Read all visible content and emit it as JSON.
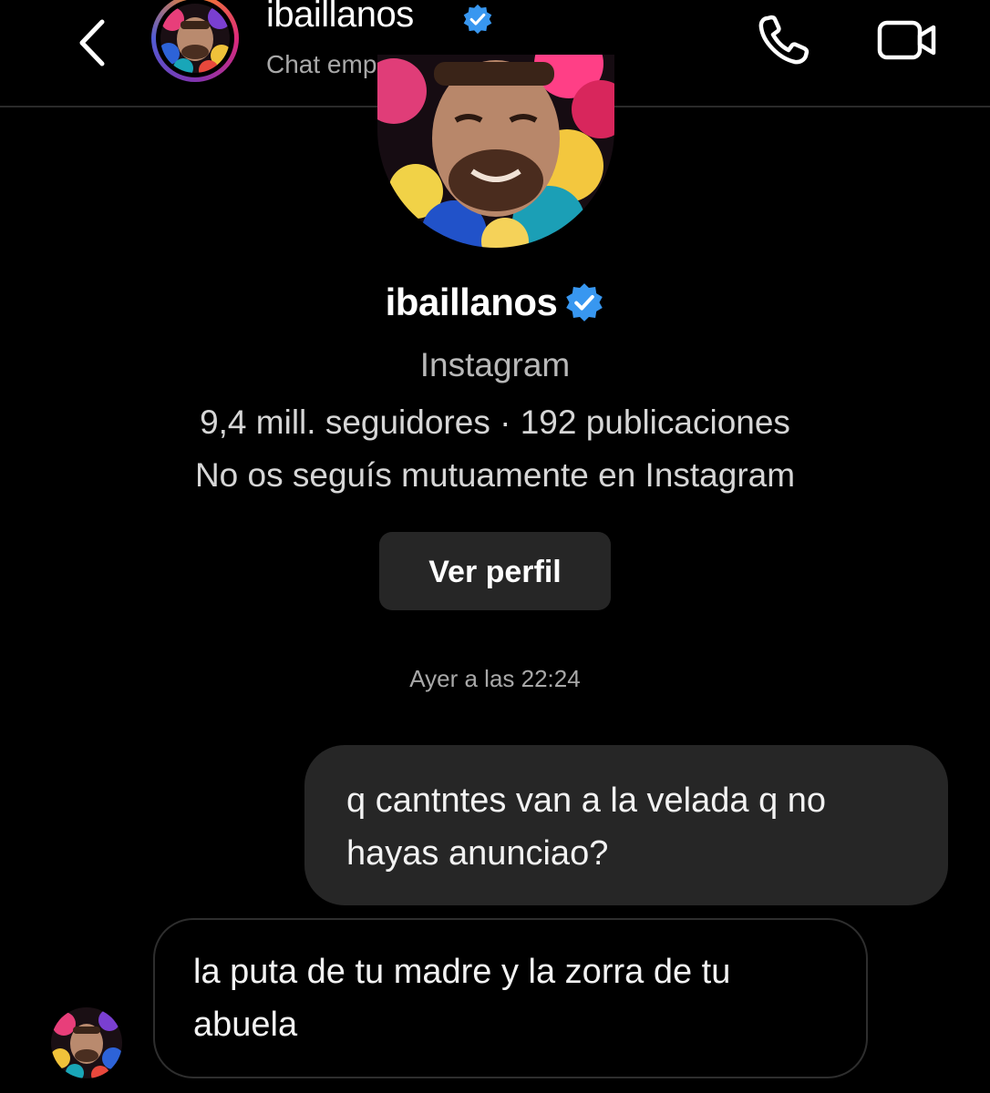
{
  "colors": {
    "background": "#000000",
    "bubble": "#262626",
    "secondary_text": "#a8a8a8",
    "verified_blue": "#3897f0"
  },
  "header": {
    "back_icon": "chevron-left-icon",
    "username": "ibaillanos",
    "subtitle": "Chat empresarial",
    "verified_icon": "verified-badge-icon",
    "call_icon": "phone-icon",
    "video_icon": "video-camera-icon"
  },
  "profile": {
    "username": "ibaillanos",
    "platform": "Instagram",
    "stats": "9,4 mill. seguidores · 192 publicaciones",
    "mutual": "No os seguís mutuamente en Instagram",
    "view_profile_label": "Ver perfil"
  },
  "conversation": {
    "timestamp": "Ayer a las 22:24",
    "messages": [
      {
        "direction": "outgoing",
        "text": "q cantntes van a la velada q no hayas anunciao?"
      },
      {
        "direction": "incoming",
        "text": "la puta de tu madre y la zorra de tu abuela"
      }
    ]
  }
}
